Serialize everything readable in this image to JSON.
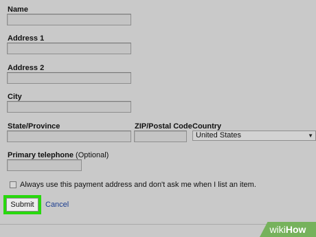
{
  "form": {
    "name_label": "Name",
    "address1_label": "Address 1",
    "address2_label": "Address 2",
    "city_label": "City",
    "state_label": "State/Province",
    "zip_label": "ZIP/Postal Code",
    "country_label": "Country",
    "country_value": "United States",
    "phone_label": "Primary telephone",
    "phone_optional": "(Optional)",
    "checkbox_label": "Always use this payment address and don't ask me when I list an item.",
    "checkbox_checked": false,
    "submit_label": "Submit",
    "cancel_label": "Cancel"
  },
  "watermark": {
    "part1": "wiki",
    "part2": "How"
  },
  "colors": {
    "background": "#c9c9c9",
    "highlight": "#28d90d",
    "link": "#1a3c8f",
    "watermark": "#76b25c"
  }
}
